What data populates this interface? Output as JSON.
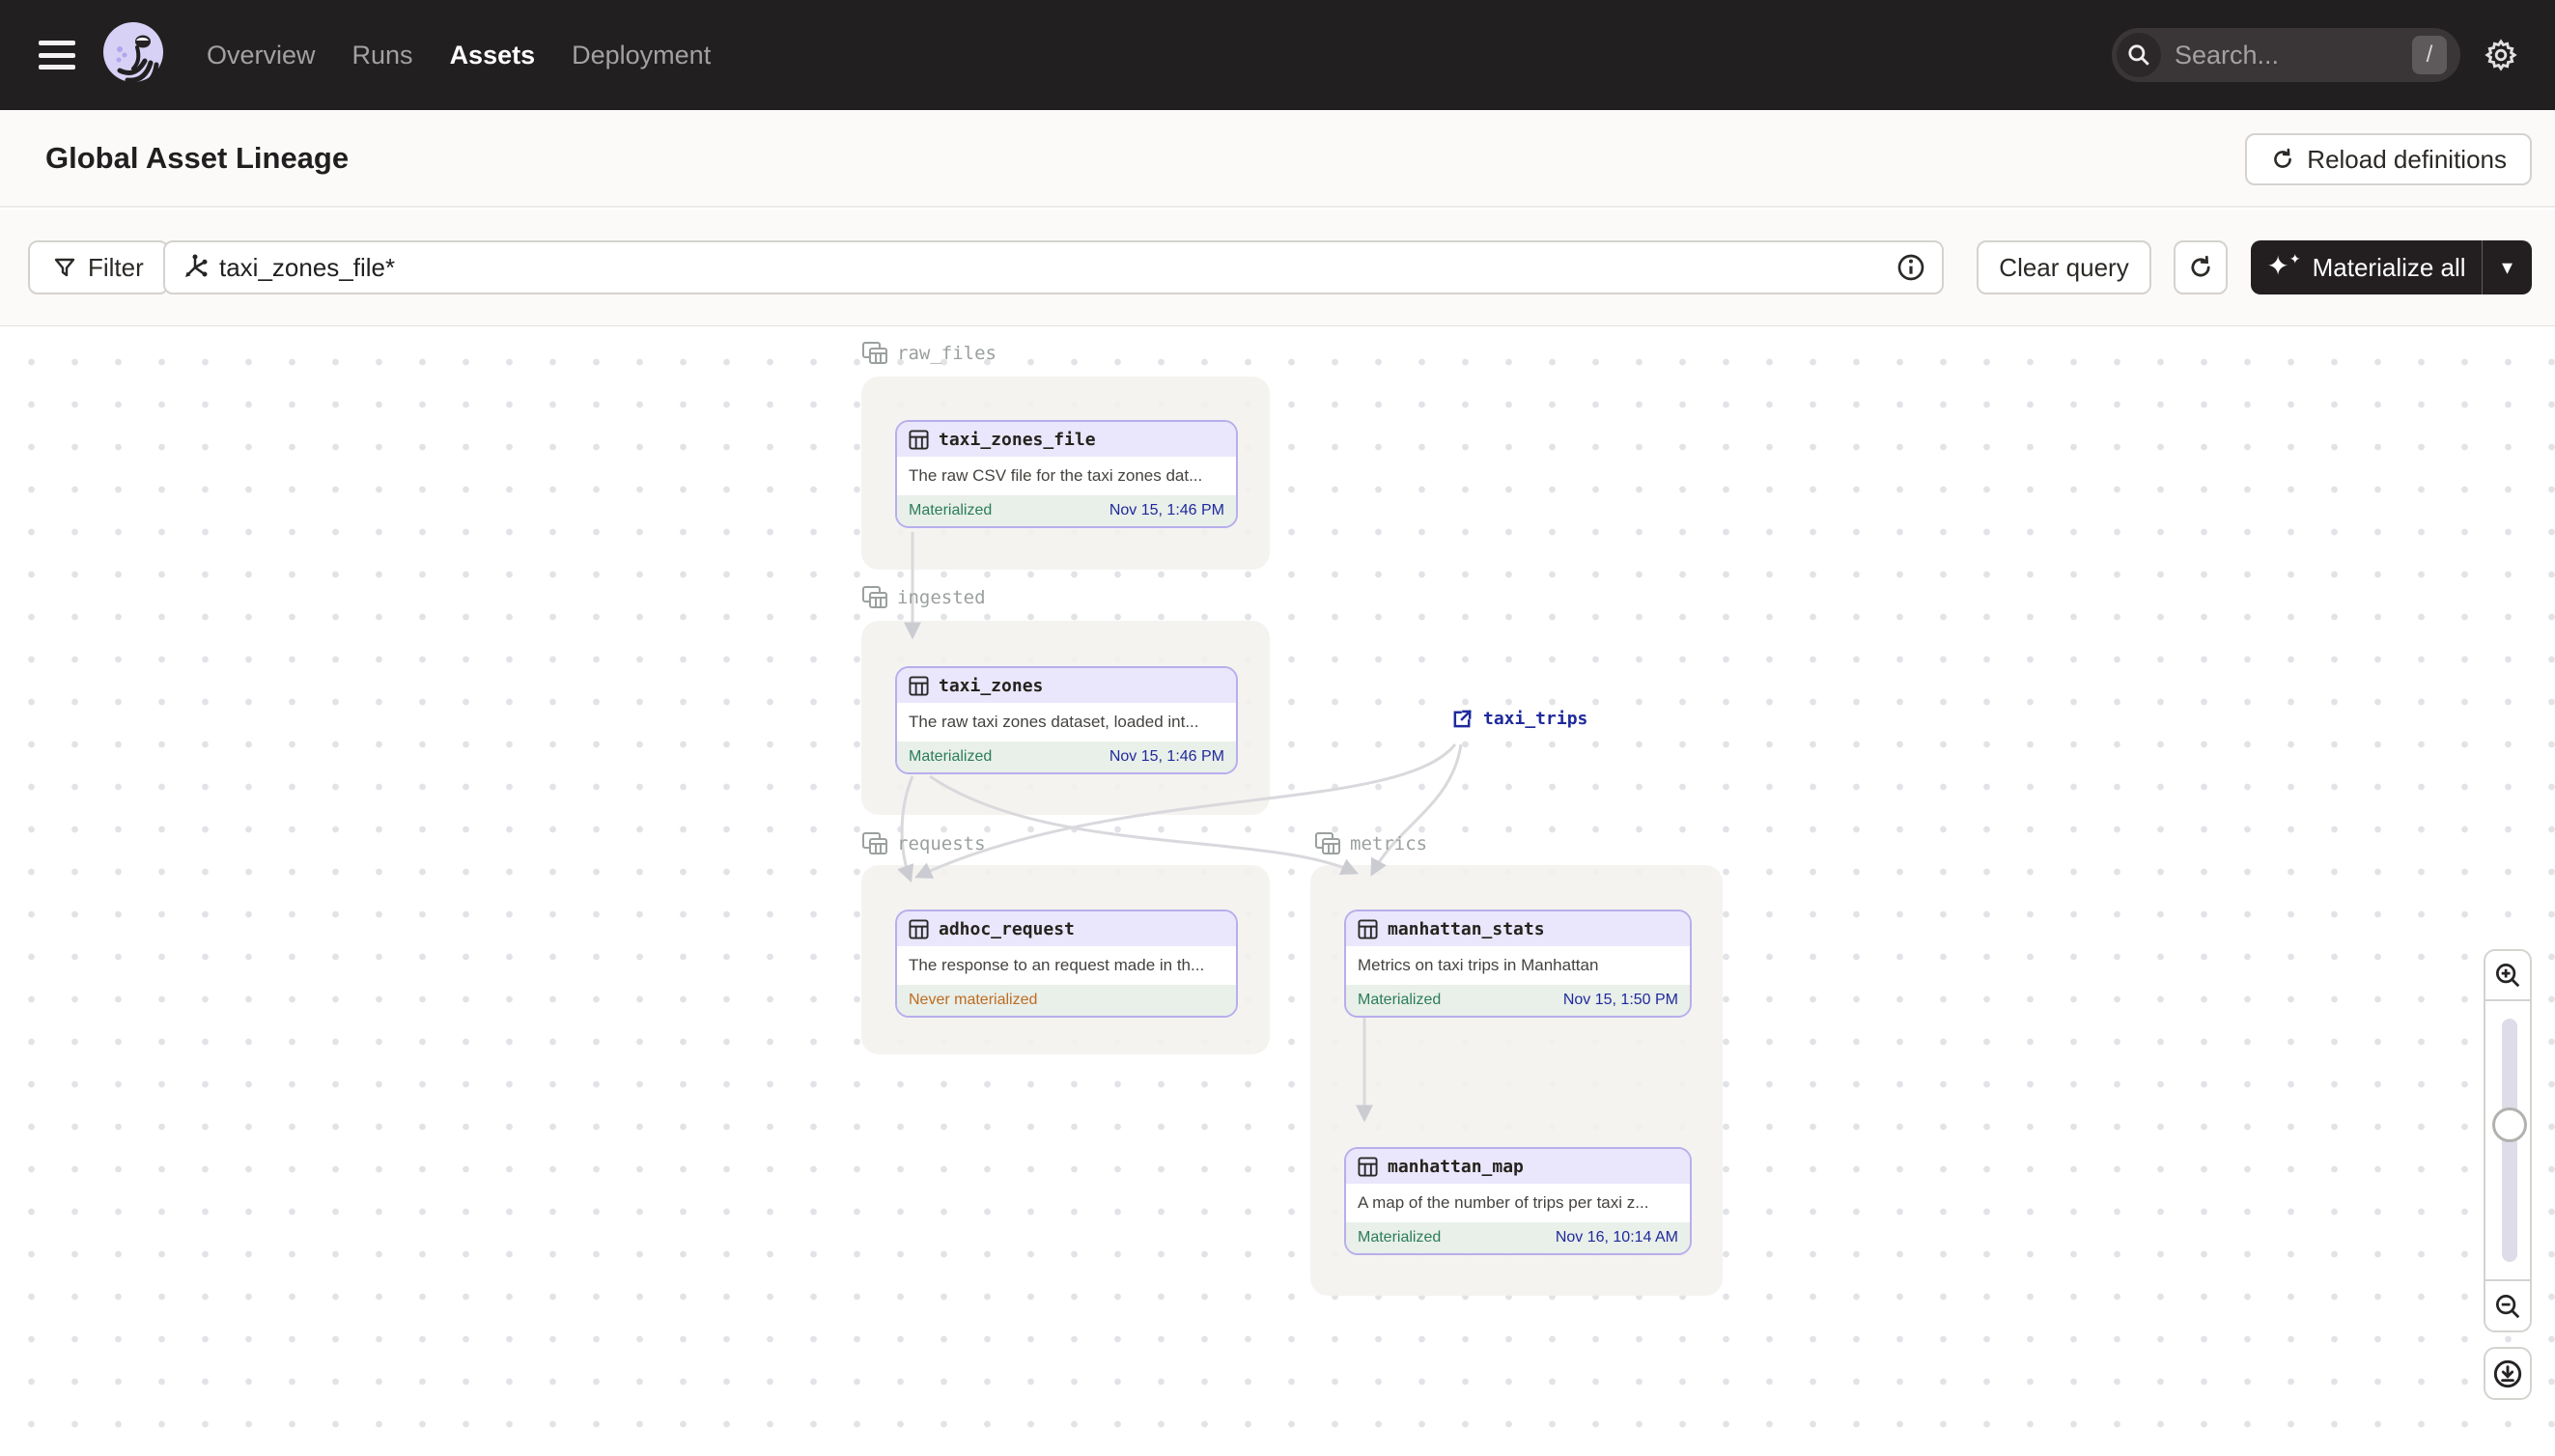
{
  "nav": {
    "tabs": [
      {
        "label": "Overview"
      },
      {
        "label": "Runs"
      },
      {
        "label": "Assets"
      },
      {
        "label": "Deployment"
      }
    ],
    "active_tab": "Assets",
    "search": {
      "placeholder": "Search...",
      "shortcut": "/"
    }
  },
  "header": {
    "title": "Global Asset Lineage",
    "reload_label": "Reload definitions"
  },
  "toolbar": {
    "filter_label": "Filter",
    "query_value": "taxi_zones_file*",
    "clear_label": "Clear query",
    "materialize_label": "Materialize all"
  },
  "graph": {
    "groups": [
      {
        "name": "raw_files"
      },
      {
        "name": "ingested"
      },
      {
        "name": "requests"
      },
      {
        "name": "metrics"
      }
    ],
    "nodes": [
      {
        "name": "taxi_zones_file",
        "description": "The raw CSV file for the taxi zones dat...",
        "status": "Materialized",
        "timestamp": "Nov 15, 1:46 PM"
      },
      {
        "name": "taxi_zones",
        "description": "The raw taxi zones dataset, loaded int...",
        "status": "Materialized",
        "timestamp": "Nov 15, 1:46 PM"
      },
      {
        "name": "adhoc_request",
        "description": "The response to an request made in th...",
        "status": "Never materialized",
        "timestamp": ""
      },
      {
        "name": "manhattan_stats",
        "description": "Metrics on taxi trips in Manhattan",
        "status": "Materialized",
        "timestamp": "Nov 15, 1:50 PM"
      },
      {
        "name": "manhattan_map",
        "description": "A map of the number of trips per taxi z...",
        "status": "Materialized",
        "timestamp": "Nov 16, 10:14 AM"
      }
    ],
    "external": {
      "name": "taxi_trips"
    }
  },
  "colors": {
    "node_border_purple": "#b7aeec",
    "materialized_green": "#2a7d5a",
    "timestamp_navy": "#1f2a9c",
    "never_materialized_orange": "#bd6c22",
    "nav_background": "#221f20"
  }
}
